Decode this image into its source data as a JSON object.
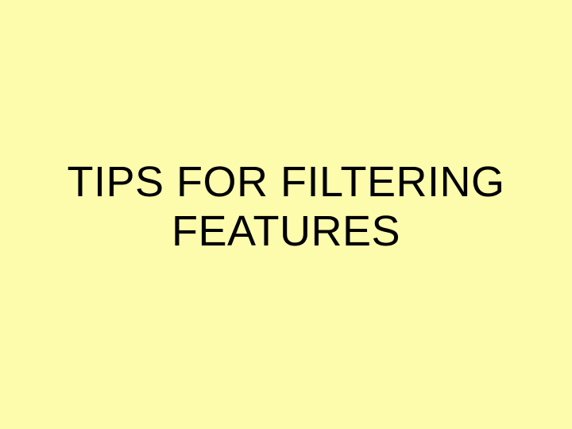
{
  "slide": {
    "title": "TIPS FOR FILTERING FEATURES"
  }
}
